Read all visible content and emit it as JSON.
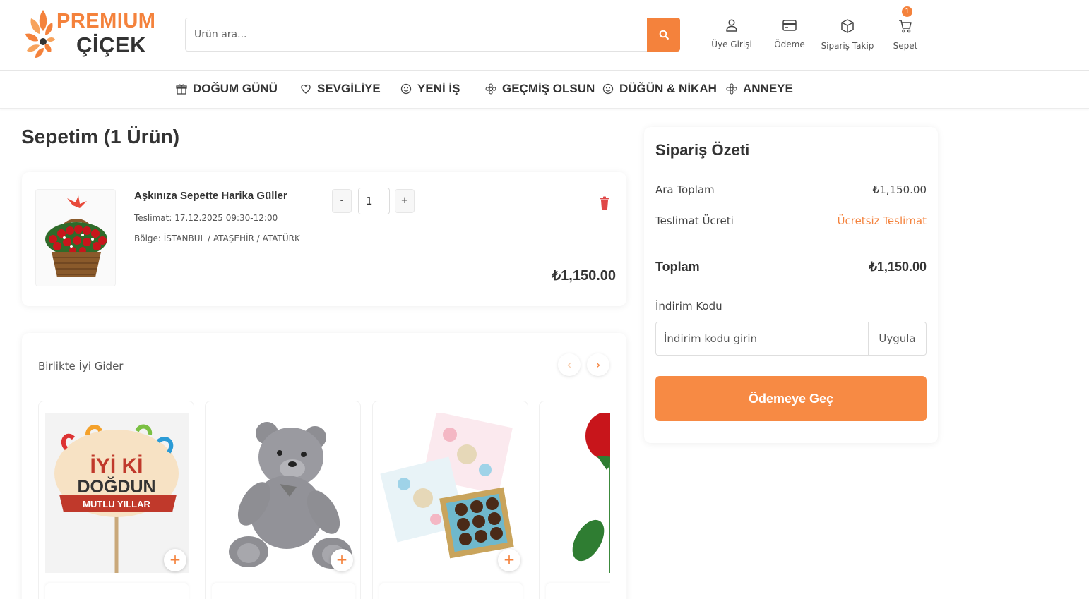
{
  "header": {
    "logo_line1": "PREMIUM",
    "logo_line2": "ÇİÇEK",
    "search_placeholder": "Ürün ara...",
    "icons": [
      {
        "label": "Üye Girişi",
        "icon": "user-icon"
      },
      {
        "label": "Ödeme",
        "icon": "credit-card-icon"
      },
      {
        "label": "Sipariş Takip",
        "icon": "box-icon"
      },
      {
        "label": "Sepet",
        "icon": "cart-icon"
      }
    ],
    "cart_count": "1"
  },
  "nav": {
    "items": [
      {
        "label": "DOĞUM GÜNÜ",
        "icon": "gift-icon"
      },
      {
        "label": "SEVGİLİYE",
        "icon": "heart-icon"
      },
      {
        "label": "YENİ İŞ",
        "icon": "smile-icon"
      },
      {
        "label": "GEÇMİŞ OLSUN",
        "icon": "flower-icon"
      },
      {
        "label": "DÜĞÜN & NİKAH",
        "icon": "smile-icon"
      },
      {
        "label": "ANNEYE",
        "icon": "flower-icon"
      }
    ]
  },
  "cart": {
    "title": "Sepetim (1 Ürün)",
    "item": {
      "name": "Aşkınıza Sepette Harika Güller",
      "delivery": "Teslimat: 17.12.2025 09:30-12:00",
      "region": "Bölge: İSTANBUL / ATAŞEHİR / ATATÜRK",
      "quantity": "1",
      "minus": "-",
      "plus": "+",
      "price": "₺1,150.00"
    }
  },
  "recommendations": {
    "title": "Birlikte İyi Gider",
    "prev": "‹",
    "next": "›",
    "products": [
      {
        "image": "İyi ki Doğdun balloon stick",
        "topper_line1": "İYİ Kİ",
        "topper_line2": "DOĞDUN",
        "topper_line3": "MUTLU YILLAR",
        "add": "+"
      },
      {
        "image": "grey teddy bear",
        "add": "+"
      },
      {
        "image": "chocolate gift box",
        "add": "+"
      },
      {
        "image": "red rose",
        "add": "+"
      }
    ]
  },
  "summary": {
    "title": "Sipariş Özeti",
    "subtotal_label": "Ara Toplam",
    "subtotal_value": "₺1,150.00",
    "shipping_label": "Teslimat Ücreti",
    "shipping_value": "Ücretsiz Teslimat",
    "total_label": "Toplam",
    "total_value": "₺1,150.00",
    "discount_label": "İndirim Kodu",
    "discount_placeholder": "İndirim kodu girin",
    "apply_label": "Uygula",
    "checkout_label": "Ödemeye Geç"
  },
  "colors": {
    "accent": "#f4823c",
    "text": "#333333"
  }
}
